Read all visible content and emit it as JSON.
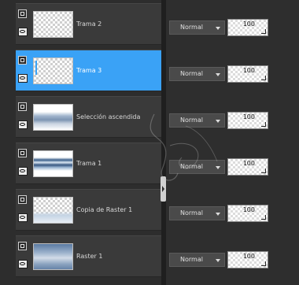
{
  "layers": [
    {
      "name": "Trama 2",
      "blend": "Normal",
      "opacity": "100"
    },
    {
      "name": "Trama 3",
      "blend": "Normal",
      "opacity": "100"
    },
    {
      "name": "Selección ascendida",
      "blend": "Normal",
      "opacity": "100"
    },
    {
      "name": "Trama 1",
      "blend": "Normal",
      "opacity": "100"
    },
    {
      "name": "Copia de Raster 1",
      "blend": "Normal",
      "opacity": "100"
    },
    {
      "name": "Raster 1",
      "blend": "Normal",
      "opacity": "100"
    }
  ],
  "selected_layer_index": 1,
  "colors": {
    "selection": "#3aa2f6",
    "panel": "#3a3a3a",
    "background": "#2b2b2b"
  }
}
